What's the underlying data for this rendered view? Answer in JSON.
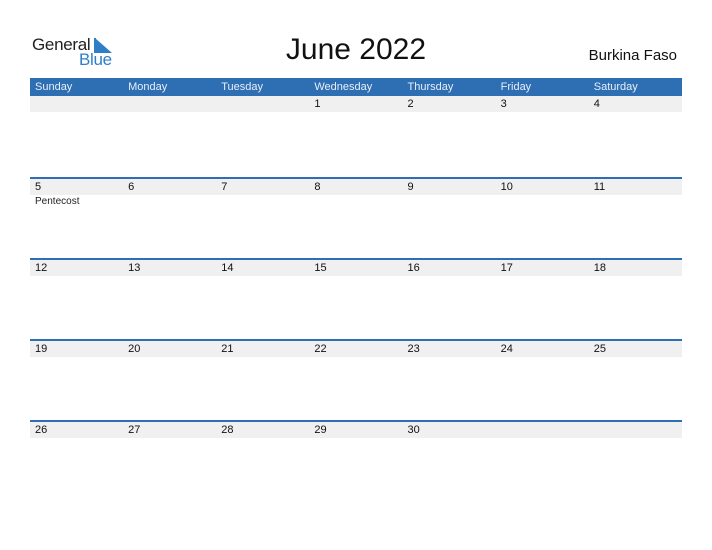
{
  "logo": {
    "general": "General",
    "blue": "Blue"
  },
  "title": "June 2022",
  "country": "Burkina Faso",
  "colors": {
    "header_bg": "#2e6fb4",
    "logo_blue": "#2f7fc8",
    "date_strip": "#f0f0f0"
  },
  "weekdays": [
    "Sunday",
    "Monday",
    "Tuesday",
    "Wednesday",
    "Thursday",
    "Friday",
    "Saturday"
  ],
  "weeks": [
    {
      "days": [
        "",
        "",
        "",
        "1",
        "2",
        "3",
        "4"
      ],
      "events": [
        "",
        "",
        "",
        "",
        "",
        "",
        ""
      ]
    },
    {
      "days": [
        "5",
        "6",
        "7",
        "8",
        "9",
        "10",
        "11"
      ],
      "events": [
        "Pentecost",
        "",
        "",
        "",
        "",
        "",
        ""
      ]
    },
    {
      "days": [
        "12",
        "13",
        "14",
        "15",
        "16",
        "17",
        "18"
      ],
      "events": [
        "",
        "",
        "",
        "",
        "",
        "",
        ""
      ]
    },
    {
      "days": [
        "19",
        "20",
        "21",
        "22",
        "23",
        "24",
        "25"
      ],
      "events": [
        "",
        "",
        "",
        "",
        "",
        "",
        ""
      ]
    },
    {
      "days": [
        "26",
        "27",
        "28",
        "29",
        "30",
        "",
        ""
      ],
      "events": [
        "",
        "",
        "",
        "",
        "",
        "",
        ""
      ]
    }
  ]
}
